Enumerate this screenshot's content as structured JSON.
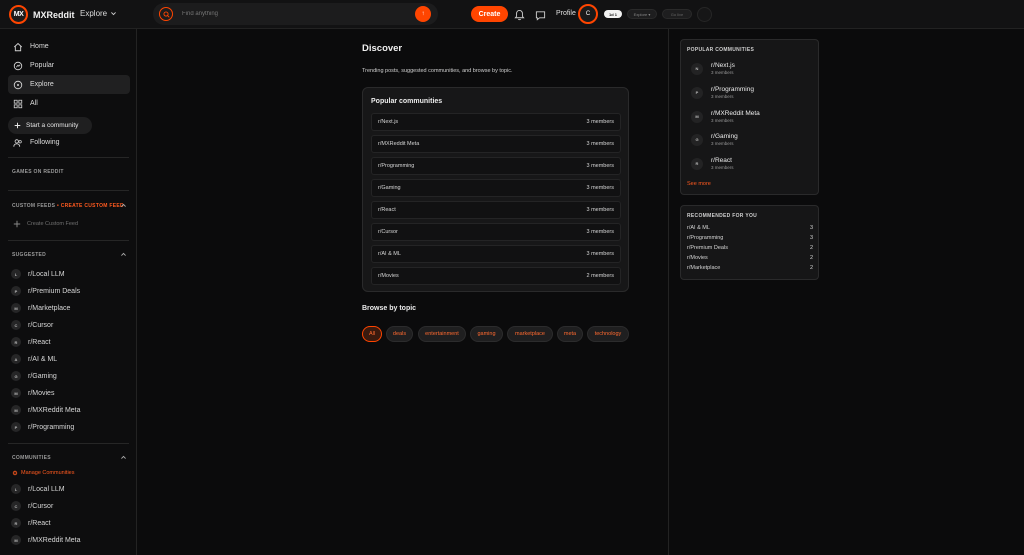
{
  "header": {
    "brand": "MXReddit",
    "brand_mark": "MX",
    "explore_label": "Explore",
    "search_placeholder": "Find anything",
    "search_go": "↑",
    "create_label": "Create",
    "profile_label": "Profile",
    "avatar_initial": "C",
    "pill_white": "1d 1",
    "pill_dark": "Explore ▾",
    "pill_dark2": "Go live"
  },
  "sidebar": {
    "nav": [
      {
        "label": "Home",
        "icon": "home-icon"
      },
      {
        "label": "Popular",
        "icon": "popular-icon"
      },
      {
        "label": "Explore",
        "icon": "explore-icon"
      },
      {
        "label": "All",
        "icon": "all-icon"
      }
    ],
    "start_community": "Start a community",
    "following": "Following",
    "games_title": "GAMES ON REDDIT",
    "custom_feeds_title": "CUSTOM FEEDS",
    "create_custom_feed_link": "CREATE CUSTOM FEED",
    "create_custom_feed": "Create Custom Feed",
    "suggested_title": "SUGGESTED",
    "suggested": [
      {
        "badge": "L",
        "name": "r/Local LLM"
      },
      {
        "badge": "P",
        "name": "r/Premium Deals"
      },
      {
        "badge": "M",
        "name": "r/Marketplace"
      },
      {
        "badge": "C",
        "name": "r/Cursor"
      },
      {
        "badge": "R",
        "name": "r/React"
      },
      {
        "badge": "A",
        "name": "r/AI & ML"
      },
      {
        "badge": "G",
        "name": "r/Gaming"
      },
      {
        "badge": "M",
        "name": "r/Movies"
      },
      {
        "badge": "M",
        "name": "r/MXReddit Meta"
      },
      {
        "badge": "P",
        "name": "r/Programming"
      }
    ],
    "communities_title": "COMMUNITIES",
    "manage_communities": "Manage Communities",
    "communities": [
      {
        "badge": "L",
        "name": "r/Local LLM"
      },
      {
        "badge": "C",
        "name": "r/Cursor"
      },
      {
        "badge": "R",
        "name": "r/React"
      },
      {
        "badge": "M",
        "name": "r/MXReddit Meta"
      }
    ]
  },
  "main": {
    "title": "Discover",
    "subtitle": "Trending posts, suggested communities, and browse by topic.",
    "popular_title": "Popular communities",
    "popular": [
      {
        "name": "r/Next.js",
        "members": "3 members"
      },
      {
        "name": "r/MXReddit Meta",
        "members": "3 members"
      },
      {
        "name": "r/Programming",
        "members": "3 members"
      },
      {
        "name": "r/Gaming",
        "members": "3 members"
      },
      {
        "name": "r/React",
        "members": "3 members"
      },
      {
        "name": "r/Cursor",
        "members": "3 members"
      },
      {
        "name": "r/AI & ML",
        "members": "3 members"
      },
      {
        "name": "r/Movies",
        "members": "2 members"
      }
    ],
    "browse_title": "Browse by topic",
    "topics": [
      "All",
      "deals",
      "entertainment",
      "gaming",
      "marketplace",
      "meta",
      "technology"
    ]
  },
  "rail": {
    "popular_title": "POPULAR COMMUNITIES",
    "popular": [
      {
        "badge": "N",
        "name": "r/Next.js",
        "members": "3 members"
      },
      {
        "badge": "P",
        "name": "r/Programming",
        "members": "3 members"
      },
      {
        "badge": "M",
        "name": "r/MXReddit Meta",
        "members": "3 members"
      },
      {
        "badge": "G",
        "name": "r/Gaming",
        "members": "3 members"
      },
      {
        "badge": "R",
        "name": "r/React",
        "members": "3 members"
      }
    ],
    "see_more": "See more",
    "recommended_title": "RECOMMENDED FOR YOU",
    "recommended": [
      {
        "name": "r/AI & ML",
        "count": "3"
      },
      {
        "name": "r/Programming",
        "count": "3"
      },
      {
        "name": "r/Premium Deals",
        "count": "2"
      },
      {
        "name": "r/Movies",
        "count": "2"
      },
      {
        "name": "r/Marketplace",
        "count": "2"
      }
    ]
  },
  "colors": {
    "accent": "#ff4500",
    "background": "#0b0b0c",
    "card": "#171718"
  }
}
